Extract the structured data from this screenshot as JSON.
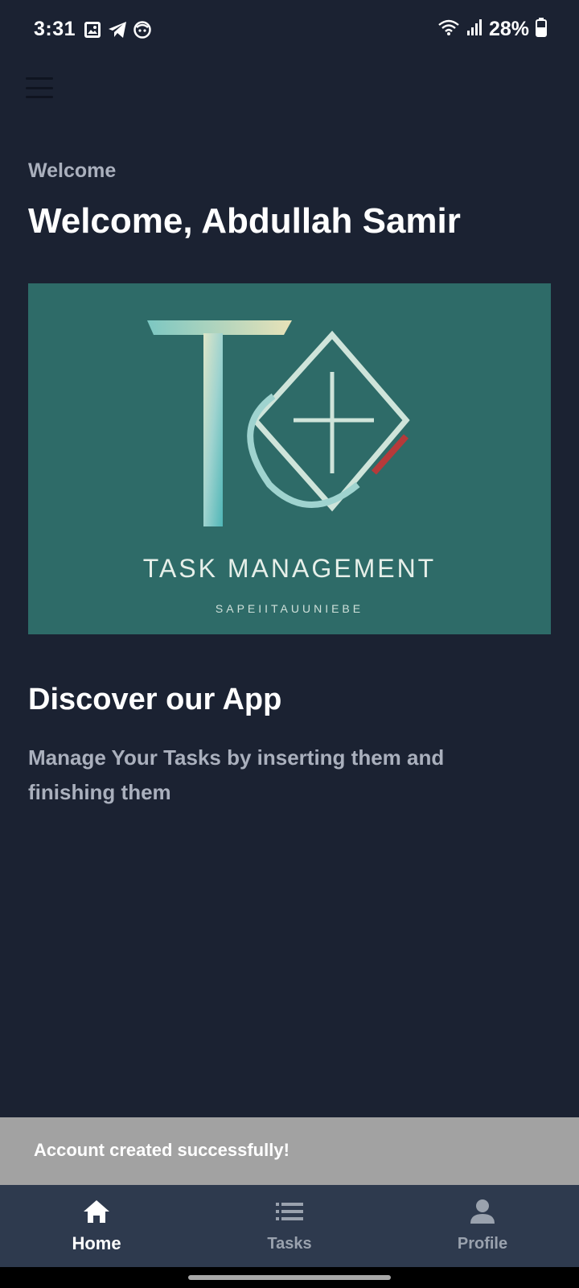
{
  "status_bar": {
    "time": "3:31",
    "battery": "28%",
    "left_icons": [
      "gallery-icon",
      "telegram-icon",
      "face-icon"
    ],
    "right_icons": [
      "wifi-icon",
      "signal-icon",
      "battery-icon"
    ]
  },
  "header": {
    "menu_icon": "hamburger-menu-icon"
  },
  "main": {
    "subtitle": "Welcome",
    "title": "Welcome, Abdullah Samir",
    "banner": {
      "title": "TASK MANAGEMENT",
      "tagline": "SAPEIITAUUNIEBE",
      "background": "#2e6b68"
    },
    "section_title": "Discover our App",
    "section_body": "Manage Your Tasks by inserting them and finishing them"
  },
  "snackbar": {
    "message": "Account created successfully!"
  },
  "bottom_nav": {
    "items": [
      {
        "label": "Home",
        "icon": "home-icon",
        "active": true
      },
      {
        "label": "Tasks",
        "icon": "list-icon",
        "active": false
      },
      {
        "label": "Profile",
        "icon": "person-icon",
        "active": false
      }
    ]
  },
  "colors": {
    "background": "#1b2232",
    "nav_background": "#2e3a4e",
    "snackbar": "#a2a2a2",
    "muted_text": "#aab0bd"
  }
}
